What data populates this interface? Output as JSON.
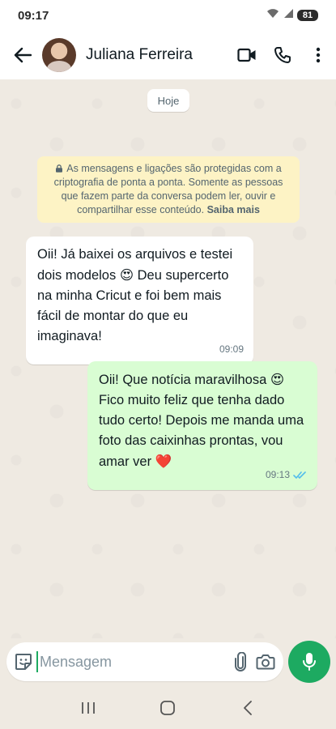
{
  "status_bar": {
    "time": "09:17",
    "signal_icons": "wifi-icon signal-icon",
    "battery": "81"
  },
  "header": {
    "contact_name": "Juliana Ferreira"
  },
  "chat": {
    "date_chip": "Hoje",
    "encryption_notice": {
      "text": "As mensagens e ligações são protegidas com a criptografia de ponta a ponta. Somente as pessoas que fazem parte da conversa podem ler, ouvir e compartilhar esse conteúdo.",
      "link": "Saiba mais"
    },
    "messages": [
      {
        "direction": "incoming",
        "text_before_emoji": "Oii! Já baixei os arquivos e testei dois modelos ",
        "emoji": "😍",
        "text_after_emoji": " Deu supercerto na minha Cricut e foi bem mais fácil de montar do que eu imaginava!",
        "time": "09:09"
      },
      {
        "direction": "outgoing",
        "text_before_emoji": "Oii! Que notícia maravilhosa ",
        "emoji": "😍",
        "text_after_emoji": " Fico muito feliz que tenha dado tudo certo! Depois me manda uma foto das caixinhas prontas, vou amar ver ",
        "emoji_end": "❤️",
        "time": "09:13",
        "status": "read"
      }
    ]
  },
  "composer": {
    "placeholder": "Mensagem"
  },
  "colors": {
    "accent": "#1daa61",
    "outgoing_bubble": "#d9fdd3",
    "read_ticks": "#53bdeb",
    "notice_bg": "#fdf3c5"
  }
}
